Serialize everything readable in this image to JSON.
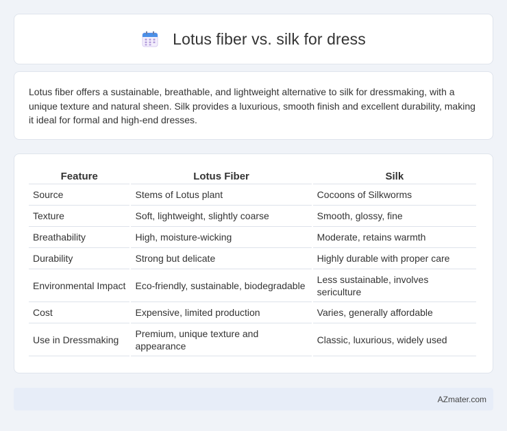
{
  "header": {
    "title": "Lotus fiber vs. silk for dress",
    "icon": "calendar-icon",
    "icon_colors": {
      "top": "#4a8fe8",
      "body": "#f3eefc",
      "dots": "#b39ddb"
    }
  },
  "intro": {
    "text": "Lotus fiber offers a sustainable, breathable, and lightweight alternative to silk for dressmaking, with a unique texture and natural sheen. Silk provides a luxurious, smooth finish and excellent durability, making it ideal for formal and high-end dresses."
  },
  "table": {
    "headers": [
      "Feature",
      "Lotus Fiber",
      "Silk"
    ],
    "rows": [
      [
        "Source",
        "Stems of Lotus plant",
        "Cocoons of Silkworms"
      ],
      [
        "Texture",
        "Soft, lightweight, slightly coarse",
        "Smooth, glossy, fine"
      ],
      [
        "Breathability",
        "High, moisture-wicking",
        "Moderate, retains warmth"
      ],
      [
        "Durability",
        "Strong but delicate",
        "Highly durable with proper care"
      ],
      [
        "Environmental Impact",
        "Eco-friendly, sustainable, biodegradable",
        "Less sustainable, involves sericulture"
      ],
      [
        "Cost",
        "Expensive, limited production",
        "Varies, generally affordable"
      ],
      [
        "Use in Dressmaking",
        "Premium, unique texture and appearance",
        "Classic, luxurious, widely used"
      ]
    ]
  },
  "footer": {
    "text": "AZmater.com"
  }
}
